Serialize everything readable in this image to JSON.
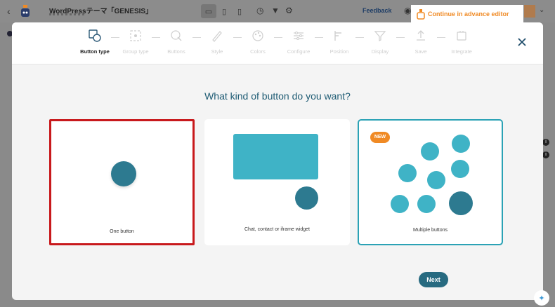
{
  "app": {
    "title": "WordPressテーマ「GENESIS」",
    "feedback": "Feedback",
    "advance_editor": "Continue in advance editor"
  },
  "wizard": {
    "steps": [
      {
        "label": "Button type",
        "icon": "button-type-icon",
        "active": true
      },
      {
        "label": "Group type",
        "icon": "group-type-icon",
        "active": false
      },
      {
        "label": "Buttons",
        "icon": "buttons-icon",
        "active": false
      },
      {
        "label": "Style",
        "icon": "style-icon",
        "active": false
      },
      {
        "label": "Colors",
        "icon": "colors-icon",
        "active": false
      },
      {
        "label": "Configure",
        "icon": "configure-icon",
        "active": false
      },
      {
        "label": "Position",
        "icon": "position-icon",
        "active": false
      },
      {
        "label": "Display",
        "icon": "display-icon",
        "active": false
      },
      {
        "label": "Save",
        "icon": "save-icon",
        "active": false
      },
      {
        "label": "Integrate",
        "icon": "integrate-icon",
        "active": false
      }
    ],
    "question": "What kind of button do you want?",
    "options": [
      {
        "label": "One button",
        "selected": true
      },
      {
        "label": "Chat, contact or iframe widget",
        "selected": false
      },
      {
        "label": "Multiple buttons",
        "selected": false,
        "badge": "NEW"
      }
    ],
    "next_label": "Next"
  },
  "colors": {
    "accent": "#2d7a90",
    "accent_light": "#3fb3c6",
    "selected_border": "#c8191c",
    "badge": "#f08a24",
    "next_button": "#276a80"
  }
}
